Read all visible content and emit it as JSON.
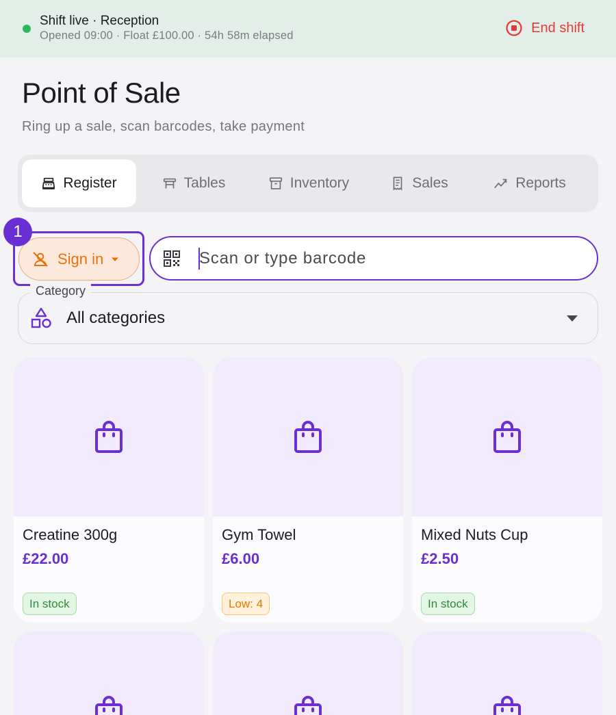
{
  "shift": {
    "title": "Shift live · Reception",
    "subtitle": "Opened 09:00 · Float £100.00 · 54h 58m elapsed",
    "end_label": "End shift",
    "status_color": "#2eb85c"
  },
  "page": {
    "title": "Point of Sale",
    "subtitle": "Ring up a sale, scan barcodes, take payment"
  },
  "tabs": [
    {
      "label": "Register",
      "icon": "cash-register-icon",
      "active": true
    },
    {
      "label": "Tables",
      "icon": "table-icon",
      "active": false
    },
    {
      "label": "Inventory",
      "icon": "archive-box-icon",
      "active": false
    },
    {
      "label": "Sales",
      "icon": "receipt-icon",
      "active": false
    },
    {
      "label": "Reports",
      "icon": "trend-chart-icon",
      "active": false
    }
  ],
  "sign_in": {
    "label": "Sign in",
    "icon": "person-off-icon",
    "step_badge": "1"
  },
  "barcode": {
    "placeholder": "Scan or type barcode",
    "icon": "qr-code-icon"
  },
  "category": {
    "label": "Category",
    "value": "All categories",
    "icon": "shapes-icon"
  },
  "products": [
    {
      "name": "Creatine 300g",
      "price": "£22.00",
      "stock": "In stock",
      "stock_level": "ok"
    },
    {
      "name": "Gym Towel",
      "price": "£6.00",
      "stock": "Low: 4",
      "stock_level": "low"
    },
    {
      "name": "Mixed Nuts Cup",
      "price": "£2.50",
      "stock": "In stock",
      "stock_level": "ok"
    }
  ],
  "colors": {
    "accent": "#6a2fd3",
    "danger": "#e53935",
    "warning": "#e8720c",
    "success": "#2e8b38"
  }
}
